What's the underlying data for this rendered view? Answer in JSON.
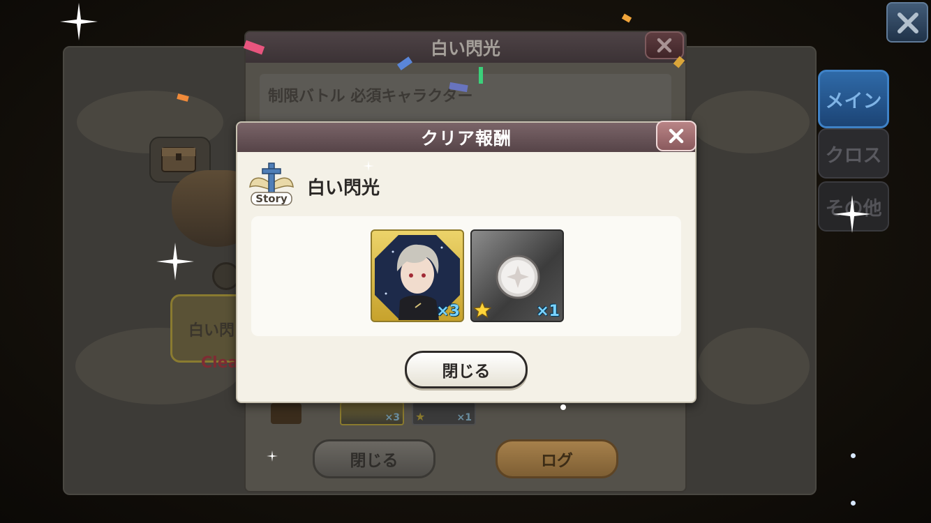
{
  "side_tabs": {
    "main": "メイン",
    "cross": "クロス",
    "other": "その他"
  },
  "background_stage": {
    "label": "白い閃",
    "clear": "Clea"
  },
  "quest_panel": {
    "title": "白い閃光",
    "requirement": "制限バトル 必須キャラクター",
    "rewards": [
      {
        "qty": "×3"
      },
      {
        "qty": "×1"
      }
    ],
    "close_label": "閉じる",
    "log_label": "ログ"
  },
  "reward_dialog": {
    "title": "クリア報酬",
    "badge_text": "Story",
    "stage_name": "白い閃光",
    "rewards": [
      {
        "type": "character",
        "qty": "×3"
      },
      {
        "type": "coin",
        "qty": "×1",
        "rarity": "star"
      }
    ],
    "close_label": "閉じる"
  },
  "icons": [
    "close-icon",
    "story-badge-icon",
    "treasure-chest-icon",
    "star-icon",
    "sparkle-icon"
  ],
  "colors": {
    "dialog_header": "#6b565a",
    "close_button": "#a87276",
    "tab_main": "#2f6aa8",
    "qty_text": "#7ad3ff"
  }
}
